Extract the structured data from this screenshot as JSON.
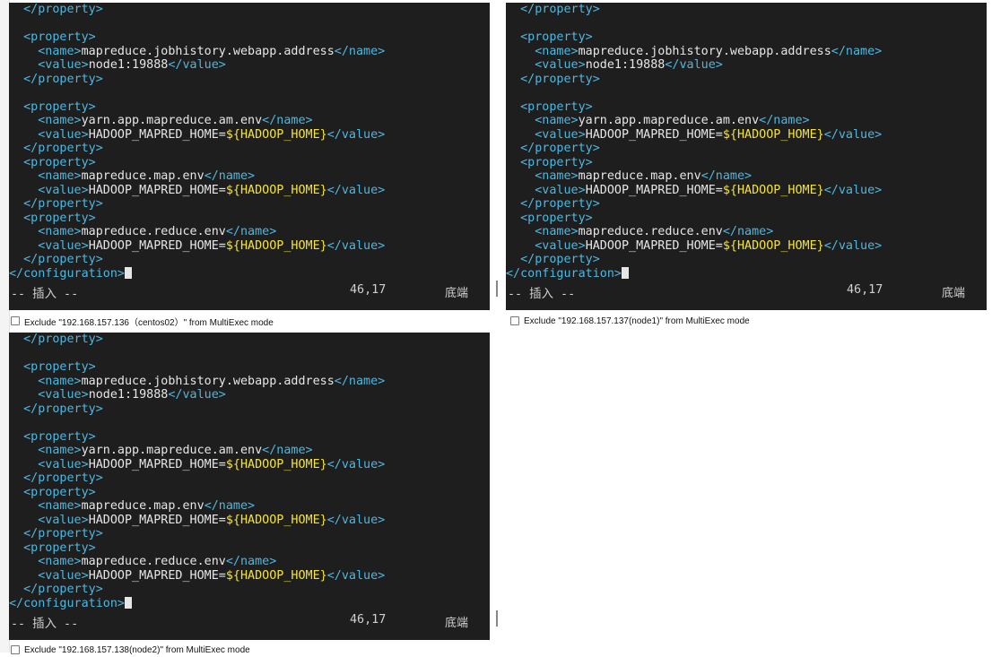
{
  "panes": [
    {
      "id": "pane-1",
      "lines": [
        "  </property>",
        "",
        "  <property>",
        "    <name>mapreduce.jobhistory.webapp.address</name>",
        "    <value>node1:19888</value>",
        "  </property>",
        "",
        "  <property>",
        "    <name>yarn.app.mapreduce.am.env</name>",
        "    <value>HADOOP_MAPRED_HOME=${HADOOP_HOME}</value>",
        "  </property>",
        "  <property>",
        "    <name>mapreduce.map.env</name>",
        "    <value>HADOOP_MAPRED_HOME=${HADOOP_HOME}</value>",
        "  </property>",
        "  <property>",
        "    <name>mapreduce.reduce.env</name>",
        "    <value>HADOOP_MAPRED_HOME=${HADOOP_HOME}</value>",
        "  </property>",
        "</configuration>"
      ],
      "mode": "-- 插入 --",
      "position": "46,17",
      "scroll": "底端",
      "exclude_label": "Exclude \"192.168.157.136（centos02）\" from MultiExec mode"
    },
    {
      "id": "pane-2",
      "lines": [
        "  </property>",
        "",
        "  <property>",
        "    <name>mapreduce.jobhistory.webapp.address</name>",
        "    <value>node1:19888</value>",
        "  </property>",
        "",
        "  <property>",
        "    <name>yarn.app.mapreduce.am.env</name>",
        "    <value>HADOOP_MAPRED_HOME=${HADOOP_HOME}</value>",
        "  </property>",
        "  <property>",
        "    <name>mapreduce.map.env</name>",
        "    <value>HADOOP_MAPRED_HOME=${HADOOP_HOME}</value>",
        "  </property>",
        "  <property>",
        "    <name>mapreduce.reduce.env</name>",
        "    <value>HADOOP_MAPRED_HOME=${HADOOP_HOME}</value>",
        "  </property>",
        "</configuration>"
      ],
      "mode": "-- 插入 --",
      "position": "46,17",
      "scroll": "底端",
      "exclude_label": "Exclude \"192.168.157.137(node1)\" from MultiExec mode"
    },
    {
      "id": "pane-3",
      "lines": [
        "  </property>",
        "",
        "  <property>",
        "    <name>mapreduce.jobhistory.webapp.address</name>",
        "    <value>node1:19888</value>",
        "  </property>",
        "",
        "  <property>",
        "    <name>yarn.app.mapreduce.am.env</name>",
        "    <value>HADOOP_MAPRED_HOME=${HADOOP_HOME}</value>",
        "  </property>",
        "  <property>",
        "    <name>mapreduce.map.env</name>",
        "    <value>HADOOP_MAPRED_HOME=${HADOOP_HOME}</value>",
        "  </property>",
        "  <property>",
        "    <name>mapreduce.reduce.env</name>",
        "    <value>HADOOP_MAPRED_HOME=${HADOOP_HOME}</value>",
        "  </property>",
        "</configuration>"
      ],
      "mode": "-- 插入 --",
      "position": "46,17",
      "scroll": "底端",
      "exclude_label": "Exclude \"192.168.157.138(node2)\" from MultiExec mode"
    }
  ],
  "colors": {
    "terminal_bg": "#1e1e1e",
    "tag": "#4fb7df",
    "text": "#e6e6e6",
    "variable": "#f2e23b"
  }
}
